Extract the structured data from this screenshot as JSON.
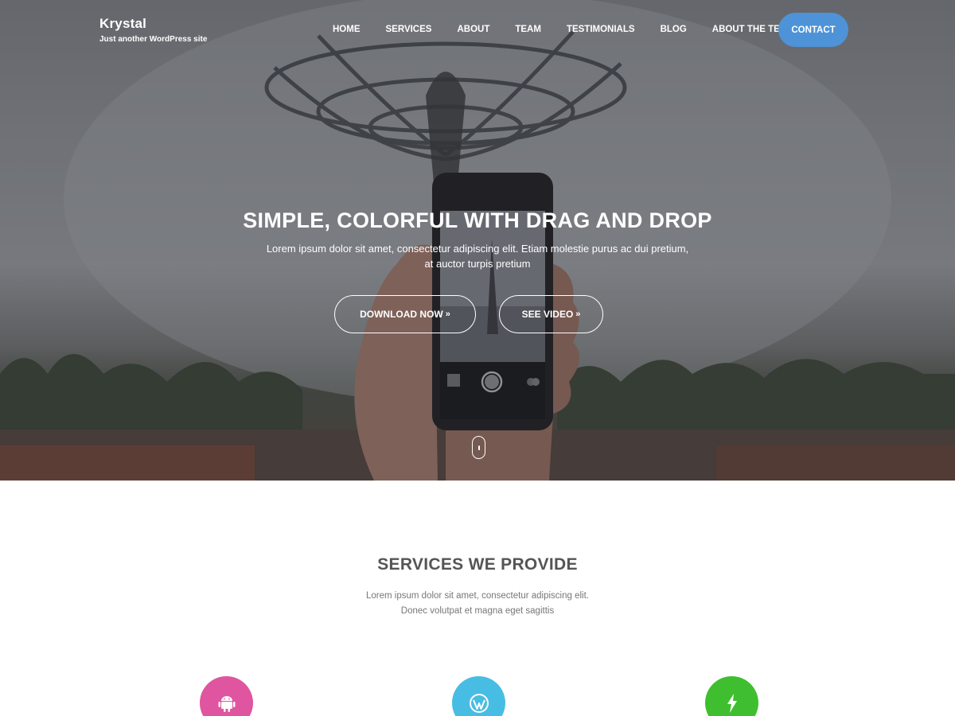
{
  "site": {
    "title": "Krystal",
    "tagline": "Just another WordPress site"
  },
  "nav": {
    "items": [
      {
        "label": "HOME"
      },
      {
        "label": "SERVICES"
      },
      {
        "label": "ABOUT"
      },
      {
        "label": "TEAM"
      },
      {
        "label": "TESTIMONIALS"
      },
      {
        "label": "BLOG"
      },
      {
        "label": "ABOUT THE TESTS",
        "has_dropdown": true
      }
    ],
    "contact_label": "CONTACT"
  },
  "hero": {
    "title": "SIMPLE, COLORFUL WITH DRAG AND DROP",
    "text": "Lorem ipsum dolor sit amet, consectetur adipiscing elit. Etiam molestie purus ac dui pretium, at auctor turpis pretium",
    "download_label": "DOWNLOAD NOW",
    "video_label": "SEE VIDEO",
    "arrow": "»"
  },
  "services": {
    "title": "SERVICES WE PROVIDE",
    "subtitle_line1": "Lorem ipsum dolor sit amet, consectetur adipiscing elit.",
    "subtitle_line2": "Donec volutpat et magna eget sagittis",
    "icons": [
      {
        "name": "android-icon",
        "color": "#e0559f"
      },
      {
        "name": "wordpress-icon",
        "color": "#48bde3"
      },
      {
        "name": "bolt-icon",
        "color": "#3fbf2f"
      }
    ]
  },
  "colors": {
    "contact_button": "#4e93d8",
    "heading": "#555555",
    "body_text": "#777777"
  }
}
